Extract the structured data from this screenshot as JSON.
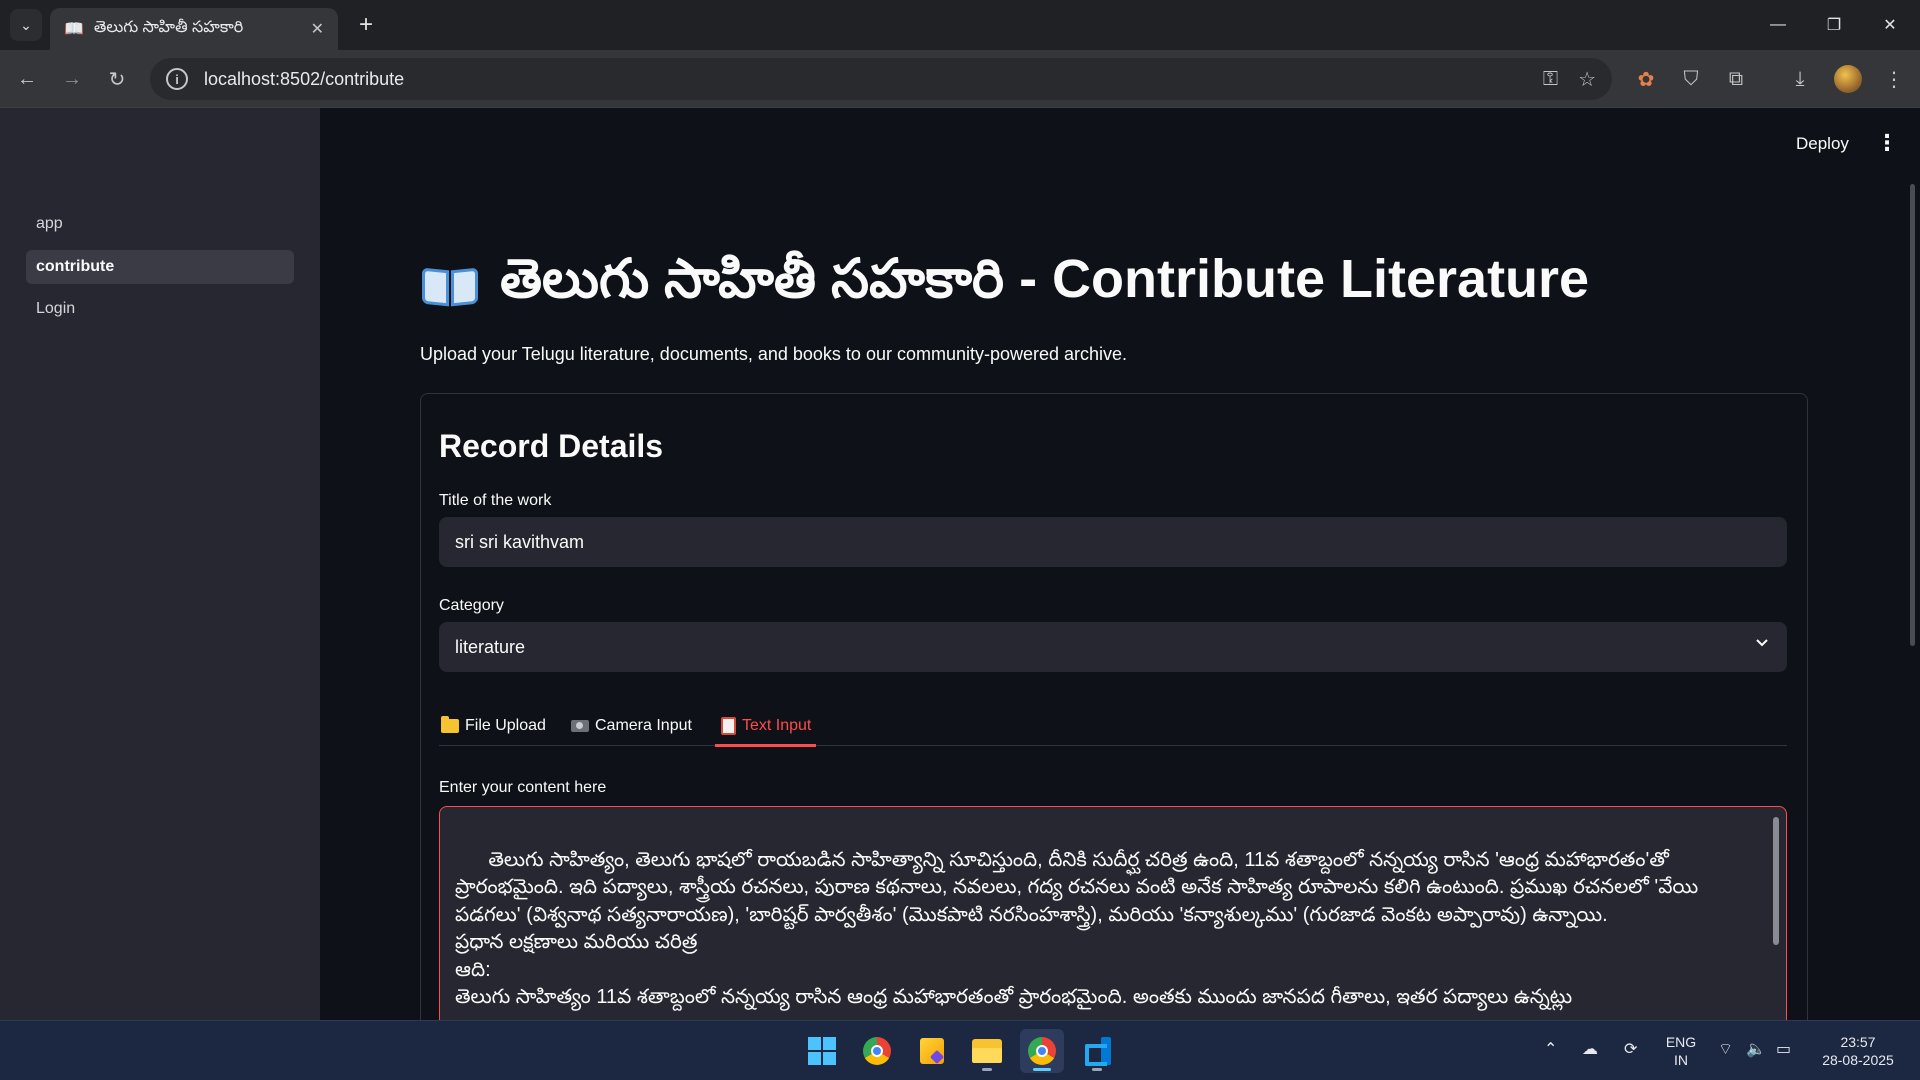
{
  "browser": {
    "tab_title": "తెలుగు సాహితీ సహకారి",
    "tab_favicon": "open-book-icon",
    "url": "localhost:8502/contribute"
  },
  "sidebar": {
    "items": [
      {
        "label": "app",
        "active": false
      },
      {
        "label": "contribute",
        "active": true
      },
      {
        "label": "Login",
        "active": false
      }
    ]
  },
  "header": {
    "deploy_label": "Deploy"
  },
  "page": {
    "title": "తెలుగు సాహితీ సహకారి - Contribute Literature",
    "subtitle": "Upload your Telugu literature, documents, and books to our community-powered archive."
  },
  "form": {
    "section_title": "Record Details",
    "title_label": "Title of the work",
    "title_value": "sri sri kavithvam",
    "category_label": "Category",
    "category_value": "literature",
    "tabs": [
      {
        "label": "File Upload",
        "icon": "folder-icon",
        "active": false
      },
      {
        "label": "Camera Input",
        "icon": "camera-icon",
        "active": false
      },
      {
        "label": "Text Input",
        "icon": "memo-icon",
        "active": true
      }
    ],
    "content_label": "Enter your content here",
    "content_value": "తెలుగు సాహిత్యం, తెలుగు భాషలో రాయబడిన సాహిత్యాన్ని సూచిస్తుంది, దీనికి సుదీర్ఘ చరిత్ర ఉంది, 11వ శతాబ్దంలో నన్నయ్య రాసిన 'ఆంధ్ర మహాభారతం'తో ప్రారంభమైంది. ఇది పద్యాలు, శాస్త్రీయ రచనలు, పురాణ కథనాలు, నవలలు, గద్య రచనలు వంటి అనేక సాహిత్య రూపాలను కలిగి ఉంటుంది. ప్రముఖ రచనలలో 'వేయి పడగలు' (విశ్వనాథ సత్యనారాయణ), 'బారిష్టర్ పార్వతీశం' (మొకపాటి నరసింహశాస్త్రి), మరియు 'కన్యాశుల్కము' (గురజాడ వెంకట అప్పారావు) ఉన్నాయి.\nప్రధాన లక్షణాలు మరియు చరిత్ర\nఆది:\nతెలుగు సాహిత్యం 11వ శతాబ్దంలో నన్నయ్య రాసిన ఆంధ్ర మహాభారతంతో ప్రారంభమైంది. అంతకు ముందు జానపద గీతాలు, ఇతర పద్యాలు ఉన్నట్లు"
  },
  "taskbar": {
    "apps": [
      "windows-start",
      "chrome",
      "sticky-notes",
      "file-explorer",
      "chrome-active",
      "vscode"
    ],
    "lang_top": "ENG",
    "lang_bottom": "IN",
    "time": "23:57",
    "date": "28-08-2025"
  },
  "colors": {
    "accent": "#ff4b4b",
    "app_bg": "#0e1117",
    "sidebar_bg": "#262730",
    "input_bg": "#262730"
  }
}
